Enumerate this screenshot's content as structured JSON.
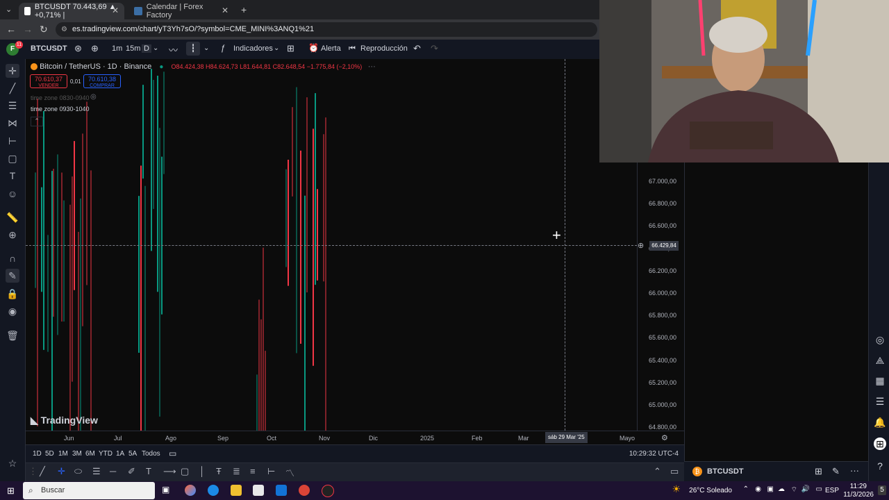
{
  "browser": {
    "tabs": [
      {
        "title": "BTCUSDT 70.443,69 ▲ +0,71% |",
        "active": true
      },
      {
        "title": "Calendar | Forex Factory",
        "active": false
      }
    ],
    "url": "es.tradingview.com/chart/yT3Yh7sO/?symbol=CME_MINI%3ANQ1%21"
  },
  "tv_toolbar": {
    "user_initial": "F",
    "user_badge": "11",
    "symbol": "BTCUSDT",
    "intervals": [
      "1m",
      "15m",
      "D"
    ],
    "indicators_label": "Indicadores",
    "alert_label": "Alerta",
    "replay_label": "Reproducción"
  },
  "chart_header": {
    "symbol_desc": "Bitcoin / TetherUS · 1D · Binance",
    "open": "O84.424,38",
    "high": "H84.624,73",
    "low": "L81.644,81",
    "close": "C82.648,54",
    "change": "−1.775,84 (−2,10%)",
    "sell_price": "70.610,37",
    "sell_label": "VENDER",
    "spread": "0,01",
    "buy_price": "70.610,38",
    "buy_label": "COMPRAR",
    "indicator1": "time zone 0830-0940",
    "indicator2": "time zone 0930-1040"
  },
  "chart_data": {
    "type": "candlestick",
    "x_ticks": [
      "Jun",
      "Jul",
      "Ago",
      "Sep",
      "Oct",
      "Nov",
      "Dic",
      "2025",
      "Feb",
      "Mar",
      "Mayo"
    ],
    "y_ticks": [
      "67.000,00",
      "66.800,00",
      "66.600,00",
      "66.400,00",
      "66.200,00",
      "66.000,00",
      "65.800,00",
      "65.600,00",
      "65.400,00",
      "65.200,00",
      "65.000,00",
      "64.800,00"
    ],
    "ylim": [
      64800,
      67000
    ],
    "crosshair_price": "66.429,84",
    "crosshair_date": "sáb 29 Mar '25",
    "watermark": "TradingView"
  },
  "range_bar": {
    "ranges": [
      "1D",
      "5D",
      "1M",
      "3M",
      "6M",
      "YTD",
      "1A",
      "5A",
      "Todos"
    ],
    "clock": "10:29:32 UTC-4"
  },
  "watchlist": {
    "symbol": "BTCUSDT"
  },
  "taskbar": {
    "search_placeholder": "Buscar",
    "weather": "26°C  Soleado",
    "lang": "ESP",
    "time": "11:29",
    "date": "11/3/2026",
    "notif": "5"
  },
  "colors": {
    "up": "#089981",
    "down": "#f23645",
    "accent": "#2962ff"
  }
}
